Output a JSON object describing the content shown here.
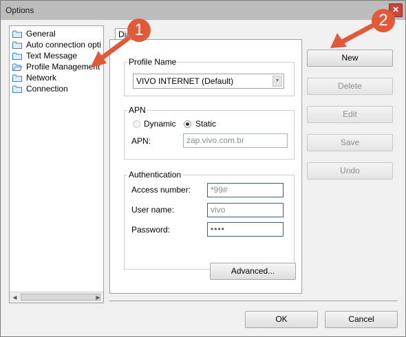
{
  "window": {
    "title": "Options",
    "close_glyph": "✕"
  },
  "tree": {
    "items": [
      {
        "label": "General",
        "icon": "folder-icon"
      },
      {
        "label": "Auto connection opti",
        "icon": "folder-icon"
      },
      {
        "label": "Text Message",
        "icon": "folder-icon"
      },
      {
        "label": "Profile Management",
        "icon": "folder-open-icon"
      },
      {
        "label": "Network",
        "icon": "folder-icon"
      },
      {
        "label": "Connection",
        "icon": "folder-icon"
      }
    ]
  },
  "tab": {
    "label": "Dia"
  },
  "profile": {
    "group_label": "Profile Name",
    "selected": "VIVO INTERNET (Default)"
  },
  "apn": {
    "group_label": "APN",
    "dynamic_label": "Dynamic",
    "static_label": "Static",
    "selected_mode": "Static",
    "apn_label": "APN:",
    "apn_value": "zap.vivo.com.br"
  },
  "auth": {
    "group_label": "Authentication",
    "access_label": "Access number:",
    "access_value": "*99#",
    "user_label": "User name:",
    "user_value": "vivo",
    "password_label": "Password:",
    "password_value": "••••"
  },
  "advanced_label": "Advanced...",
  "actions": {
    "new": "New",
    "delete": "Delete",
    "edit": "Edit",
    "save": "Save",
    "undo": "Undo"
  },
  "footer": {
    "ok": "OK",
    "cancel": "Cancel"
  },
  "annotations": {
    "badge1": "1",
    "badge2": "2"
  },
  "colors": {
    "accent": "#e05a3a",
    "titlebar": "#bcbcbc",
    "close": "#c9463d"
  }
}
